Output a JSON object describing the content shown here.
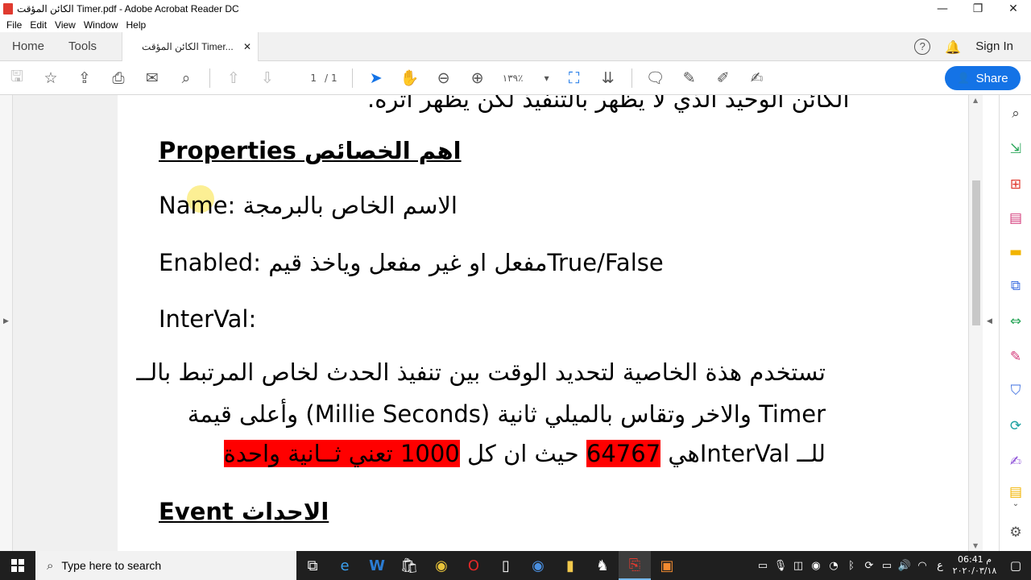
{
  "window": {
    "title": "الكائن المؤقت Timer.pdf - Adobe Acrobat Reader DC",
    "minimize_glyph": "—",
    "maximize_glyph": "❐",
    "close_glyph": "✕"
  },
  "menu": [
    "File",
    "Edit",
    "View",
    "Window",
    "Help"
  ],
  "tabs": {
    "home": "Home",
    "tools": "Tools",
    "document": "الكائن المؤقت Timer...",
    "close_glyph": "✕",
    "help_glyph": "?",
    "sign_in": "Sign In"
  },
  "toolbar": {
    "page_current": "1",
    "page_sep": "/",
    "page_total": "1",
    "zoom": "١٣٩٪",
    "zoom_caret": "▾",
    "share_label": "Share",
    "accent": "#1473e6"
  },
  "document": {
    "line_top": "الكائن الوحيد الذي لا يظهر بالتنفيذ لكن يظهر اثره.",
    "properties_heading": "Properties اهم الخصائص",
    "name_line": "Name: الاسم الخاص بالبرمجة",
    "enabled_prefix": "Enabled:  مفعل او غير مفعل وياخذ قيم",
    "enabled_values": "True/False",
    "interval_label": "InterVal:",
    "para_line1": "تستخدم هذة الخاصية لتحديد الوقت بين تنفيذ الحدث لخاص المرتبط بالــ",
    "para_line2": "Timer والاخر وتقاس بالميلي ثانية (Millie Seconds) وأعلى قيمة",
    "para_line3_a": "للــ InterValهي",
    "para_line3_num": "64767",
    "para_line3_b": "حيث ان كل",
    "para_line3_hl": "1000 تعني ثــانية واحدة",
    "event_heading": "Event الاحداث",
    "highlight_color": "#ff0000"
  },
  "taskbar": {
    "search_placeholder": "Type here to search",
    "tray_lang": "ع",
    "time": "06:41 م",
    "date": "٢٠٢٠/٠٣/١٨"
  }
}
